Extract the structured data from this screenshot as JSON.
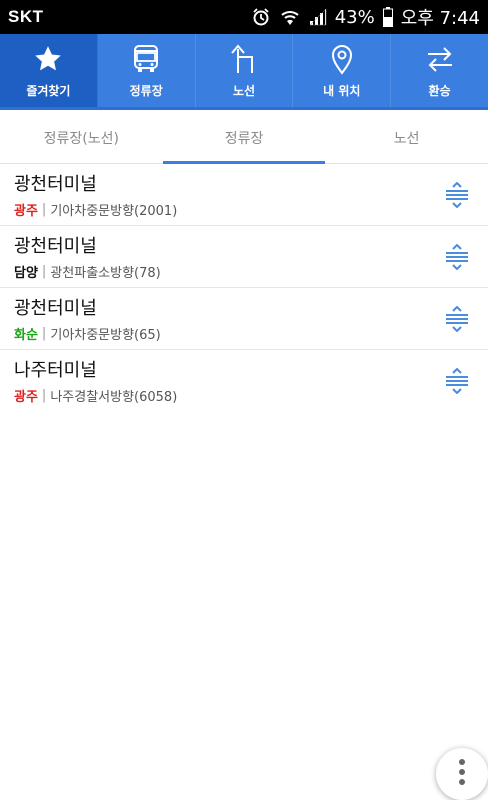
{
  "status_bar": {
    "carrier": "SKT",
    "battery": "43%",
    "time": "오후 7:44"
  },
  "nav": {
    "items": [
      {
        "label": "즐겨찾기",
        "icon": "star-icon"
      },
      {
        "label": "정류장",
        "icon": "bus-icon"
      },
      {
        "label": "노선",
        "icon": "route-arrow-icon"
      },
      {
        "label": "내 위치",
        "icon": "location-pin-icon"
      },
      {
        "label": "환승",
        "icon": "transfer-icon"
      }
    ],
    "active_index": 0
  },
  "sub_tabs": {
    "items": [
      {
        "label": "정류장(노선)"
      },
      {
        "label": "정류장"
      },
      {
        "label": "노선"
      }
    ],
    "active_index": 1
  },
  "favorites": [
    {
      "name": "광천터미널",
      "region": "광주",
      "region_color": "#e02020",
      "direction": "기아차중문방향(2001)"
    },
    {
      "name": "광천터미널",
      "region": "담양",
      "region_color": "#111111",
      "direction": "광천파출소방향(78)"
    },
    {
      "name": "광천터미널",
      "region": "화순",
      "region_color": "#1aa51a",
      "direction": "기아차중문방향(65)"
    },
    {
      "name": "나주터미널",
      "region": "광주",
      "region_color": "#e02020",
      "direction": "나주경찰서방향(6058)"
    }
  ],
  "colors": {
    "accent": "#3a7fe0",
    "accent_dark": "#1e5fc4",
    "handle": "#4a8ce0"
  }
}
